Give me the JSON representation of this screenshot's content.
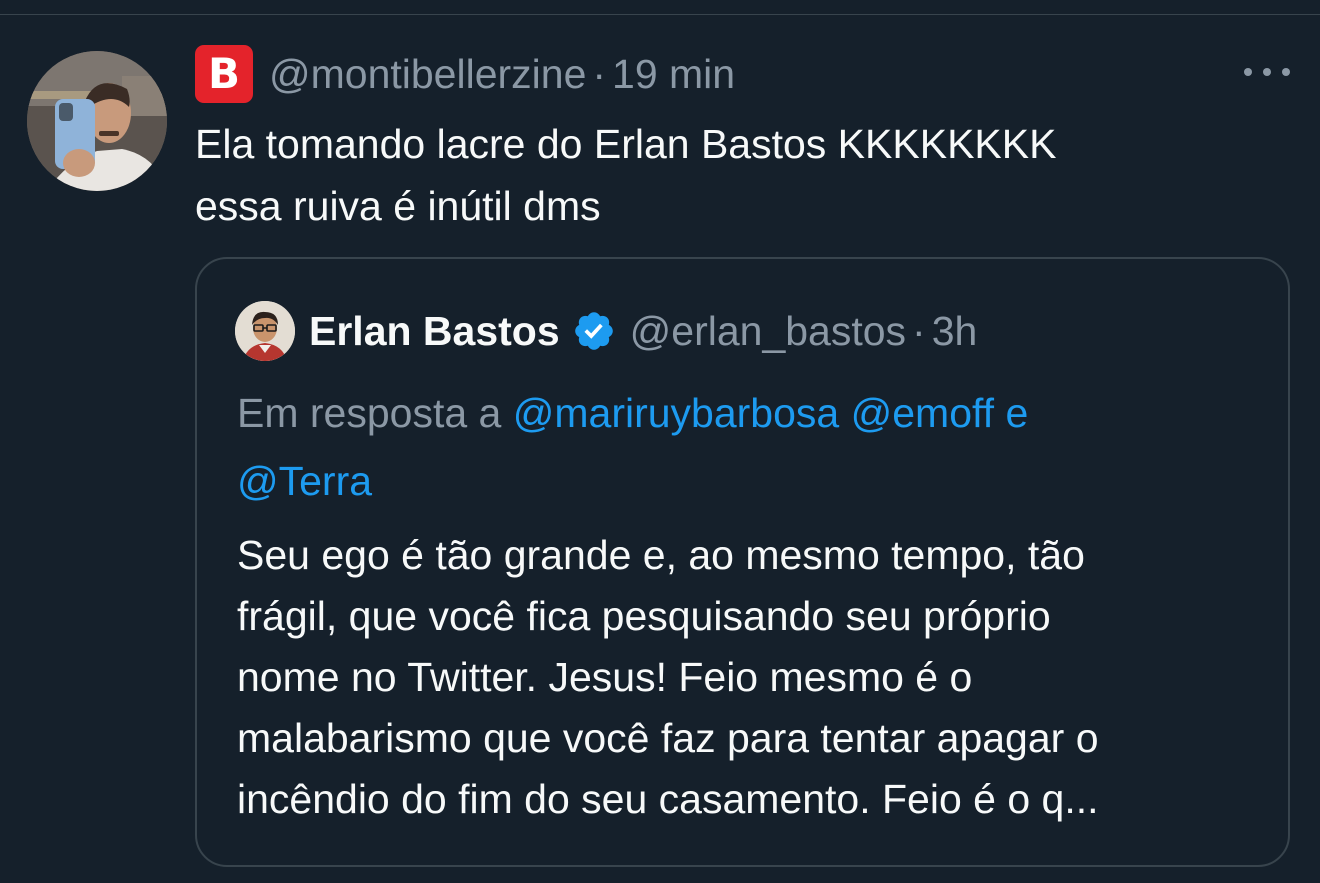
{
  "tweet": {
    "badge_letter": "B",
    "handle": "@montibellerzine",
    "separator": "·",
    "time": "19 min",
    "text_lines": [
      "Ela tomando lacre do Erlan Bastos KKKKKKKK",
      "essa ruiva é inútil dms"
    ],
    "more_icon": "more-horizontal-icon"
  },
  "quote": {
    "name": "Erlan Bastos",
    "verified_icon": "verified-badge-icon",
    "handle": "@erlan_bastos",
    "separator": "·",
    "time": "3h",
    "reply": {
      "prefix": "Em resposta a",
      "mention1": "@mariruybarbosa",
      "mention2": "@emoff",
      "conjunction": "e",
      "mention3": "@Terra"
    },
    "text_lines": [
      "Seu ego é tão grande e, ao mesmo tempo, tão",
      "frágil, que você fica pesquisando seu próprio",
      "nome no Twitter. Jesus! Feio mesmo é o",
      "malabarismo que você faz para tentar apagar o",
      "incêndio do fim do seu casamento. Feio é o q..."
    ]
  },
  "colors": {
    "background": "#15202b",
    "text_primary": "#f7f9f9",
    "text_secondary": "#8b98a5",
    "link": "#1d9bf0",
    "border": "#38444d",
    "badge_red": "#e4232b",
    "verified_blue": "#1d9bf0"
  }
}
